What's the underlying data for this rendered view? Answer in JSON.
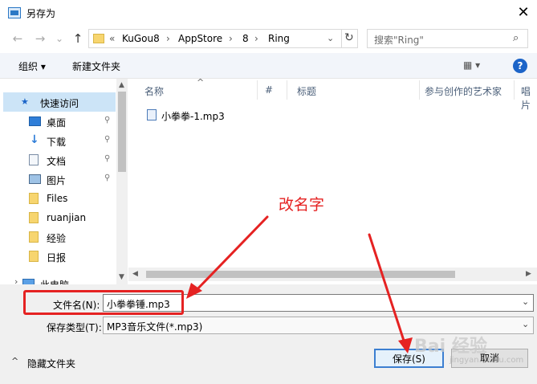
{
  "window": {
    "title": "另存为",
    "close_glyph": "✕"
  },
  "nav_buttons": {
    "back": "←",
    "forward": "→",
    "dropdown": "⌄",
    "up": "↑"
  },
  "address": {
    "prefix": "«",
    "crumbs": [
      "KuGou8",
      "AppStore",
      "8",
      "Ring"
    ],
    "separator": "›",
    "dropdown_glyph": "⌄",
    "refresh_glyph": "↻"
  },
  "search": {
    "placeholder": "搜索\"Ring\"",
    "icon_glyph": "⌕"
  },
  "toolbar": {
    "organize": "组织 ▾",
    "new_folder": "新建文件夹",
    "view_glyph": "▦ ▾",
    "help": "?"
  },
  "sidebar": {
    "items": [
      {
        "label": "快速访问",
        "icon": "star-icon",
        "pinned": false,
        "selected": true
      },
      {
        "label": "桌面",
        "icon": "desktop-icon",
        "pinned": true
      },
      {
        "label": "下载",
        "icon": "download-icon",
        "pinned": true
      },
      {
        "label": "文档",
        "icon": "document-icon",
        "pinned": true
      },
      {
        "label": "图片",
        "icon": "picture-icon",
        "pinned": true
      },
      {
        "label": "Files",
        "icon": "folder-icon",
        "pinned": false
      },
      {
        "label": "ruanjian",
        "icon": "folder-icon",
        "pinned": false
      },
      {
        "label": "经验",
        "icon": "folder-icon",
        "pinned": false
      },
      {
        "label": "日报",
        "icon": "folder-icon",
        "pinned": false
      },
      {
        "label": "此电脑",
        "icon": "computer-icon",
        "pinned": false
      }
    ],
    "pin_glyph": "⚲",
    "star_glyph": "★",
    "expand_glyph": "›"
  },
  "file_list": {
    "columns": [
      "名称",
      "#",
      "标题",
      "参与创作的艺术家",
      "唱片"
    ],
    "sort_glyph": "^",
    "files": [
      {
        "name": "小拳拳-1.mp3",
        "icon": "audio-file-icon"
      }
    ]
  },
  "scroll": {
    "up": "▲",
    "down": "▼",
    "left": "◀",
    "right": "▶"
  },
  "form": {
    "filename_label": "文件名(N):",
    "filename_value": "小拳拳锤.mp3",
    "filetype_label": "保存类型(T):",
    "filetype_value": "MP3音乐文件(*.mp3)",
    "dropdown_glyph": "⌄"
  },
  "footer": {
    "hide_folders": "隐藏文件夹",
    "hide_glyph": "^",
    "save": "保存(S)",
    "cancel": "取消"
  },
  "annotation": {
    "text": "改名字",
    "color": "#e52222"
  },
  "watermark": {
    "brand": "Bai 经验",
    "sub": "jingyan.baidu.com"
  },
  "colors": {
    "selection": "#cce4f7",
    "accent": "#3c7fd1",
    "annotation_red": "#e52222"
  }
}
